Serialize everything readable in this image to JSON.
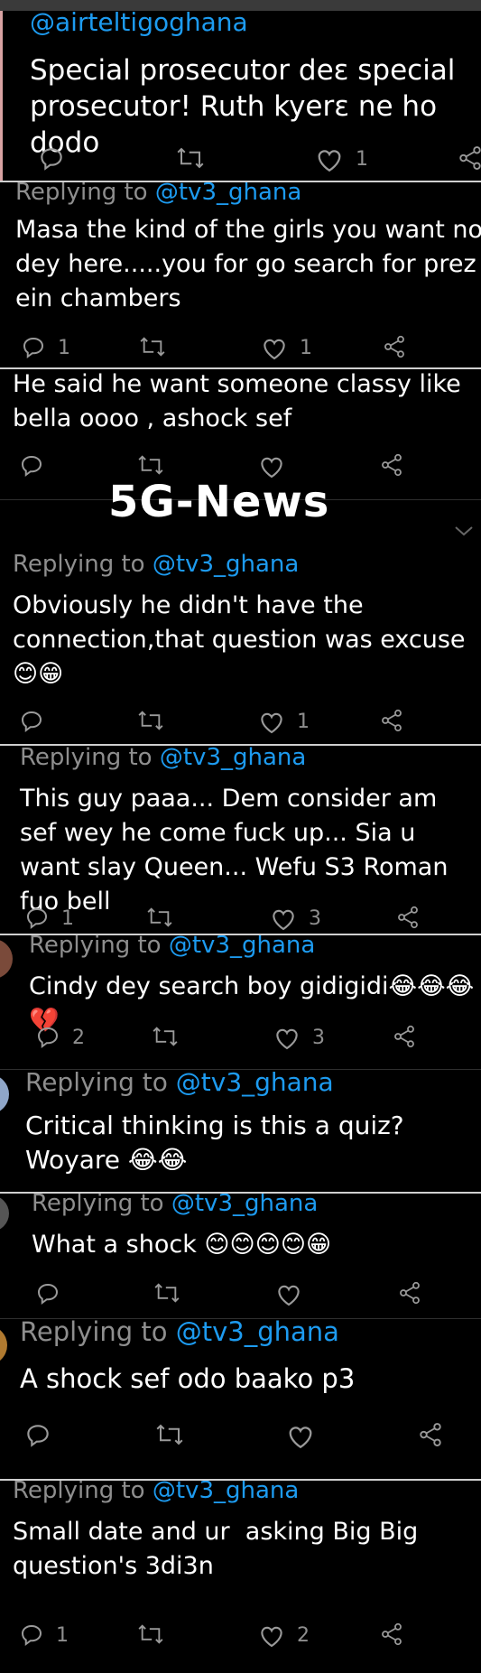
{
  "tweets": [
    {
      "handle": "@airteltigoghana",
      "text": "Special prosecutor deɛ special prosecutor! Ruth kyerɛ ne ho dodo",
      "replies": "",
      "likes": "1"
    },
    {
      "reply_prefix": "Replying to",
      "mention": "@tv3_ghana",
      "text": "Masa the kind of the girls you want no dey here.....you for go search for prez ein chambers",
      "replies": "1",
      "likes": "1"
    },
    {
      "text": "He said he want someone classy like bella oooo , ashock sef",
      "replies": "",
      "likes": ""
    },
    {
      "reply_prefix": "Replying to",
      "mention": "@tv3_ghana",
      "text": "Obviously he didn't have the connection,that question was excuse 😊😁",
      "replies": "",
      "likes": "1"
    },
    {
      "reply_prefix": "Replying to",
      "mention": "@tv3_ghana",
      "text": "This guy paaa... Dem consider am sef wey he come fuck up... Sia u want slay Queen... Wefu S3 Roman fuo bell",
      "replies": "1",
      "likes": "3"
    },
    {
      "reply_prefix": "Replying to",
      "mention": "@tv3_ghana",
      "text": "Cindy dey search boy gidigidi😂😂😂💔",
      "replies": "2",
      "likes": "3"
    },
    {
      "reply_prefix": "Replying to",
      "mention": "@tv3_ghana",
      "text": "Critical thinking is this a quiz? Woyare 😂😂",
      "replies": "",
      "likes": ""
    },
    {
      "reply_prefix": "Replying to",
      "mention": "@tv3_ghana",
      "text": "What a shock 😊😊😊😊😁",
      "replies": "",
      "likes": ""
    },
    {
      "reply_prefix": "Replying to",
      "mention": "@tv3_ghana",
      "text": "A shock sef odo baako p3",
      "replies": "",
      "likes": ""
    },
    {
      "reply_prefix": "Replying to",
      "mention": "@tv3_ghana",
      "text": "Small date and ur  asking Big Big question's 3di3n",
      "replies": "1",
      "likes": "2"
    }
  ],
  "watermark": "5G-News",
  "icons": [
    "reply-icon",
    "retweet-icon",
    "like-icon",
    "share-icon",
    "chevron-down-icon"
  ],
  "colors": {
    "mention": "#1d9bf0",
    "muted": "#8e8e8e",
    "background": "#000000"
  }
}
